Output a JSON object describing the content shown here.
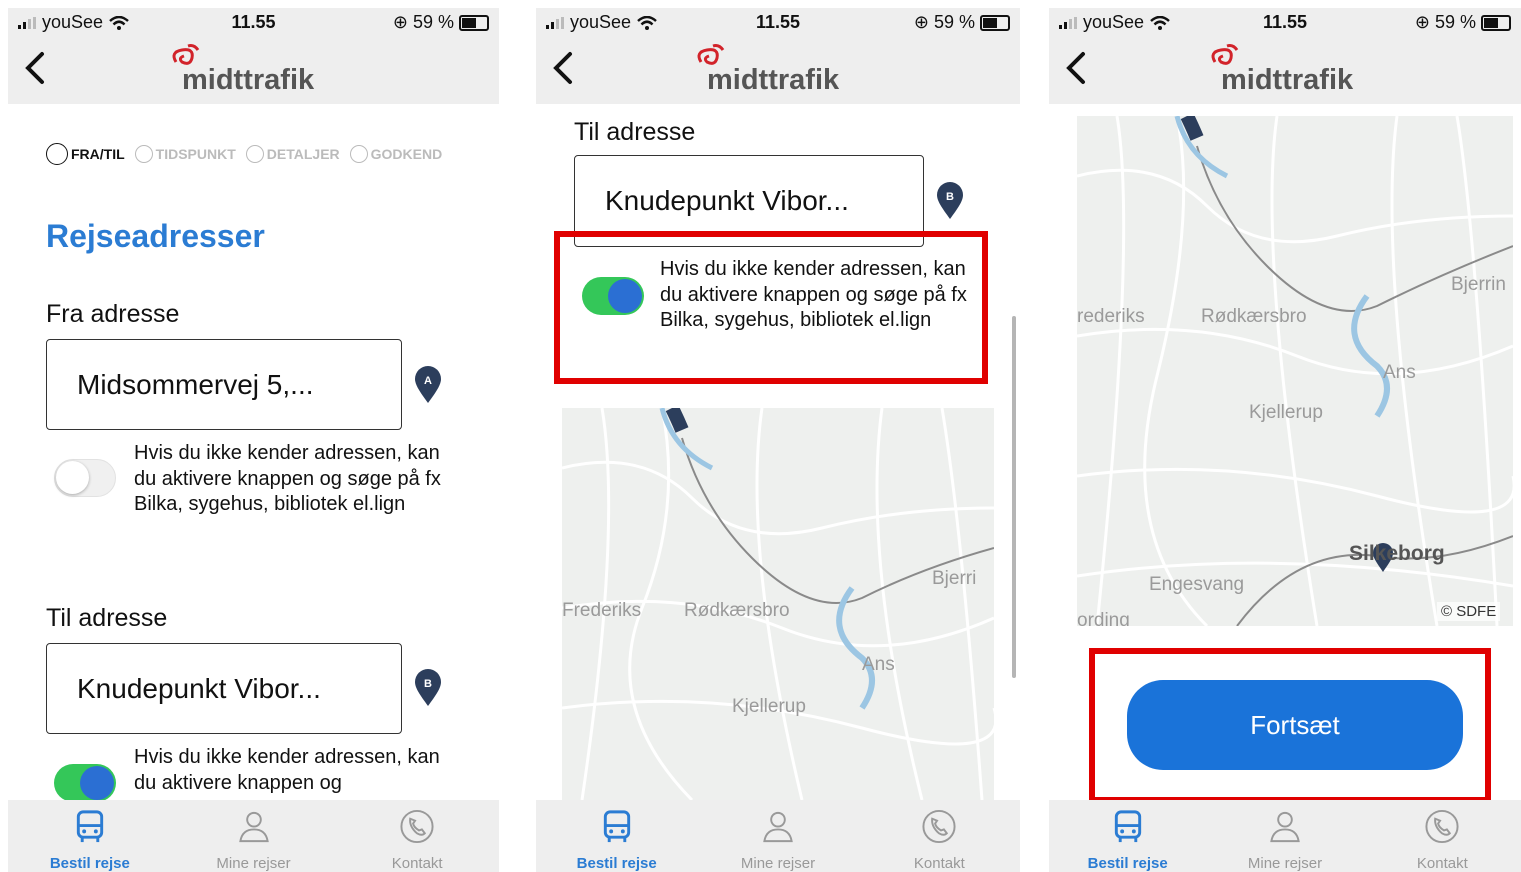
{
  "status": {
    "carrier": "youSee",
    "time": "11.55",
    "battery": "59 %"
  },
  "brand": {
    "name": "midttrafik",
    "accent": "#2b7cd3",
    "logo_red": "#d2232a"
  },
  "steps": [
    {
      "label": "FRA/TIL"
    },
    {
      "label": "TIDSPUNKT"
    },
    {
      "label": "DETALJER"
    },
    {
      "label": "GODKEND"
    }
  ],
  "form": {
    "title": "Rejseadresser",
    "from_label": "Fra adresse",
    "from_value": "Midsommervej 5,...",
    "to_label": "Til adresse",
    "to_value": "Knudepunkt Vibor...",
    "help_text": "Hvis du ikke kender adressen, kan du aktivere knappen og søge på fx Bilka, sygehus, bibliotek el.lign",
    "help_text_truncated": "Hvis du ikke kender adressen, kan du aktivere knappen og",
    "pin_a": "A",
    "pin_b": "B"
  },
  "map": {
    "labels": {
      "bjerring": "Bjerri",
      "bjerring3": "Bjerrin",
      "frederiks": "Frederiks",
      "frederiks3": "rederiks",
      "rodkaersbro": "Rødkærsbro",
      "ans": "Ans",
      "kjellerup": "Kjellerup",
      "silkeborg": "Silkeborg",
      "engesvang": "Engesvang",
      "ording": "ording"
    },
    "credit": "© SDFE"
  },
  "continue_button": "Fortsæt",
  "tabs": [
    {
      "label": "Bestil rejse",
      "icon": "bus-icon"
    },
    {
      "label": "Mine rejser",
      "icon": "person-icon"
    },
    {
      "label": "Kontakt",
      "icon": "phone-icon"
    }
  ],
  "highlight_color": "#e00000"
}
